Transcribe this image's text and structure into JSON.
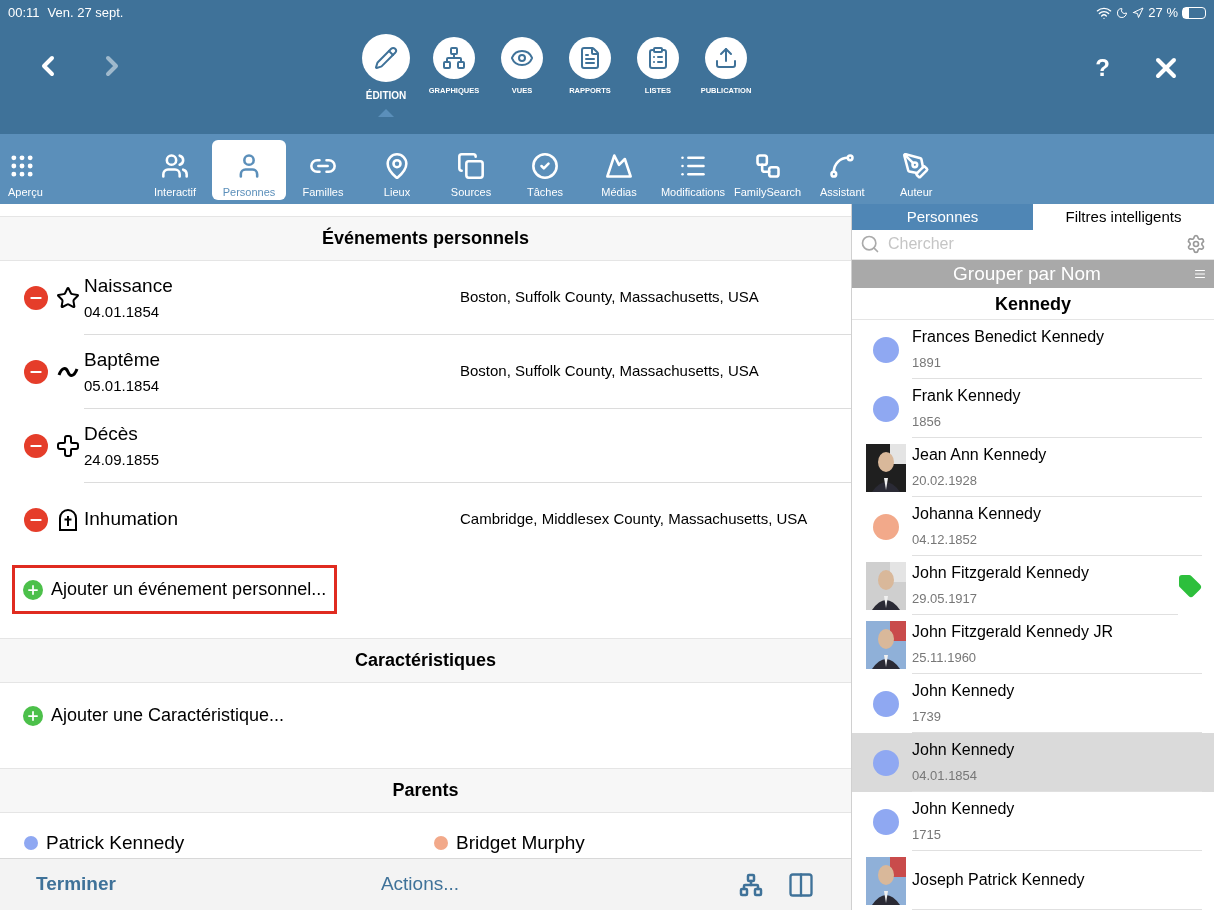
{
  "status_bar": {
    "time": "00:11",
    "date": "Ven. 27 sept.",
    "battery": "27 %"
  },
  "modes": [
    {
      "label": "ÉDITION",
      "selected": true,
      "kind": "edit"
    },
    {
      "label": "GRAPHIQUES",
      "selected": false,
      "kind": "chart"
    },
    {
      "label": "VUES",
      "selected": false,
      "kind": "view"
    },
    {
      "label": "RAPPORTS",
      "selected": false,
      "kind": "report"
    },
    {
      "label": "LISTES",
      "selected": false,
      "kind": "list"
    },
    {
      "label": "PUBLICATION",
      "selected": false,
      "kind": "publish"
    }
  ],
  "help": "?",
  "toolbar": [
    {
      "label": "Aperçu",
      "selected": false,
      "kind": "grid"
    },
    {
      "label": "Interactif",
      "selected": false,
      "kind": "tree"
    },
    {
      "label": "Personnes",
      "selected": true,
      "kind": "person"
    },
    {
      "label": "Familles",
      "selected": false,
      "kind": "rings"
    },
    {
      "label": "Lieux",
      "selected": false,
      "kind": "pin"
    },
    {
      "label": "Sources",
      "selected": false,
      "kind": "sources"
    },
    {
      "label": "Tâches",
      "selected": false,
      "kind": "check"
    },
    {
      "label": "Médias",
      "selected": false,
      "kind": "media"
    },
    {
      "label": "Modifications",
      "selected": false,
      "kind": "list"
    },
    {
      "label": "FamilySearch",
      "selected": false,
      "kind": "network"
    },
    {
      "label": "Assistant",
      "selected": false,
      "kind": "bow"
    },
    {
      "label": "Auteur",
      "selected": false,
      "kind": "pen"
    }
  ],
  "events_section": {
    "title": "Événements personnels",
    "events": [
      {
        "kind": "birth",
        "name": "Naissance",
        "date": "04.01.1854",
        "place": "Boston, Suffolk County, Massachusetts, USA"
      },
      {
        "kind": "baptism",
        "name": "Baptême",
        "date": "05.01.1854",
        "place": "Boston, Suffolk County, Massachusetts, USA"
      },
      {
        "kind": "death",
        "name": "Décès",
        "date": "24.09.1855"
      },
      {
        "kind": "burial",
        "name": "Inhumation",
        "place": "Cambridge, Middlesex County, Massachusetts, USA"
      }
    ],
    "add": {
      "label": "Ajouter un événement personnel...",
      "highlighted": true
    }
  },
  "characteristics_section": {
    "title": "Caractéristiques",
    "add": {
      "label": "Ajouter une Caractéristique...",
      "highlighted": false
    }
  },
  "parents_section": {
    "title": "Parents",
    "parents": [
      {
        "name": "Patrick Kennedy",
        "color": "#8fa8f2"
      },
      {
        "name": "Bridget Murphy",
        "color": "#f2a98a"
      }
    ]
  },
  "bottom_bar": {
    "done": "Terminer",
    "actions": "Actions..."
  },
  "side_tabs": [
    {
      "label": "Personnes",
      "selected": true
    },
    {
      "label": "Filtres intelligents",
      "selected": false
    }
  ],
  "search": {
    "placeholder": "Chercher"
  },
  "group_bar": "Grouper par Nom",
  "group_title": "Kennedy",
  "persons": [
    {
      "name": "Frances Benedict Kennedy",
      "date": "1891",
      "kind": "dot",
      "color": "#8fa8f2",
      "selected": false,
      "tagged": false
    },
    {
      "name": "Frank Kennedy",
      "date": "1856",
      "kind": "dot",
      "color": "#8fa8f2",
      "selected": false,
      "tagged": false
    },
    {
      "name": "Jean Ann Kennedy",
      "date": "20.02.1928",
      "kind": "picture",
      "selected": false,
      "tagged": false
    },
    {
      "name": "Johanna Kennedy",
      "date": "04.12.1852",
      "kind": "dot",
      "color": "#f2a98a",
      "selected": false,
      "tagged": false
    },
    {
      "name": "John Fitzgerald Kennedy",
      "date": "29.05.1917",
      "kind": "picture",
      "selected": false,
      "tagged": true
    },
    {
      "name": "John Fitzgerald Kennedy JR",
      "date": "25.11.1960",
      "kind": "picture",
      "selected": false,
      "tagged": false
    },
    {
      "name": "John Kennedy",
      "date": "1739",
      "kind": "dot",
      "color": "#8fa8f2",
      "selected": false,
      "tagged": false
    },
    {
      "name": "John Kennedy",
      "date": "04.01.1854",
      "kind": "dot",
      "color": "#8fa8f2",
      "selected": true,
      "tagged": false
    },
    {
      "name": "John Kennedy",
      "date": "1715",
      "kind": "dot",
      "color": "#8fa8f2",
      "selected": false,
      "tagged": false
    },
    {
      "name": "Joseph Patrick Kennedy",
      "kind": "picture",
      "selected": false,
      "tagged": false
    }
  ]
}
